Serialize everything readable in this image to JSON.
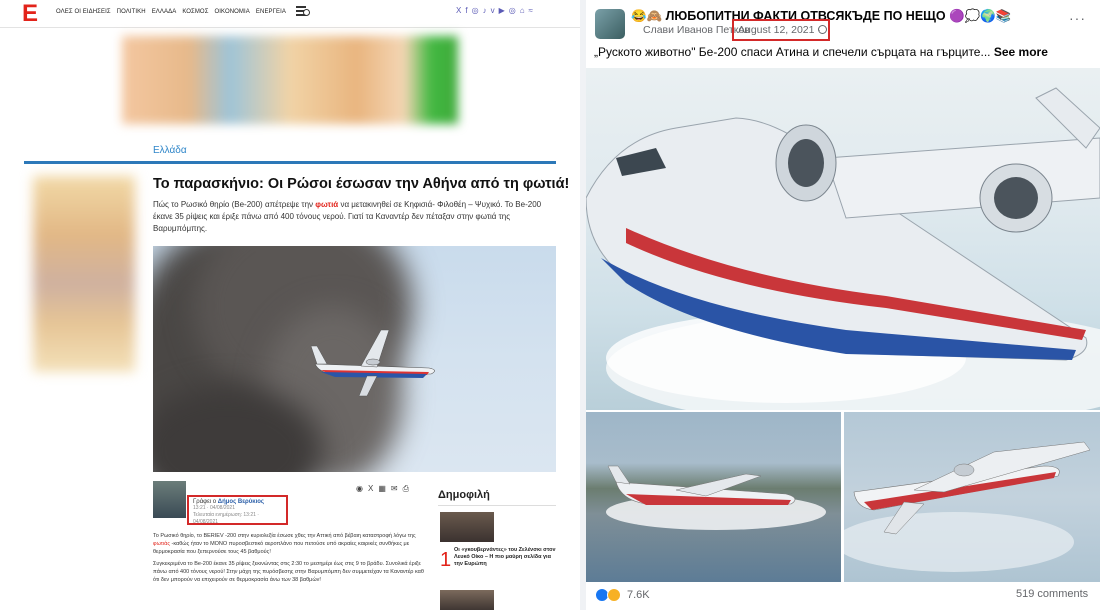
{
  "news_site": {
    "logo": "E",
    "nav": [
      "ΟΛΕΣ ΟΙ ΕΙΔΗΣΕΙΣ",
      "ΠΟΛΙΤΙΚΗ",
      "ΕΛΛΑΔΑ",
      "ΚΟΣΜΟΣ",
      "ΟΙΚΟΝΟΜΙΑ",
      "ΕΝΕΡΓΕΙΑ"
    ],
    "social_icons": [
      "X",
      "f",
      "◎",
      "♪",
      "v",
      "▶",
      "◎",
      "⌂",
      "≈"
    ],
    "category": "Ελλάδα",
    "article": {
      "title": "Το παρασκήνιο: Οι Ρώσοι έσωσαν την Αθήνα από τη φωτιά!",
      "lead_before": "Πώς το Ρωσικό θηρίο (Be-200) απέτρεψε την ",
      "lead_highlight": "φωτιά",
      "lead_after": " να μετακινηθεί σε Κηφισιά- Φιλοθέη – Ψυχικό. Το Be-200 έκανε 35 ρίψεις και έριξε πάνω από 400 τόνους νερού. Γιατί τα Καναντέρ δεν πέταξαν στην φωτιά της Βαρυμπόμπης.",
      "author_prefix": "Γράφει ο ",
      "author_name": "Δήμος Βερύκιος",
      "time_published": "13:21 · 04/08/2021",
      "time_updated": "Τελευταία ενημέρωση: 13:21 · 04/08/2021",
      "share_icons": [
        "◉",
        "X",
        "▦",
        "✉",
        "⎙"
      ],
      "body_p1_before": "Το Ρωσικό θηρίο, το BERIEV -200 στην κυριολεξία έσωσε χθες την Αττική από βέβαιη καταστροφή λόγω της ",
      "body_p1_highlight": "φωτιάς",
      "body_p1_after": " -καθώς ήταν το ΜΟΝΟ πυροσβεστικό αεροπλάνο που πετούσε υπό ακραίες καιρικές συνθήκες με θερμοκρασία που ξεπερνούσε τους 45 βαθμούς!",
      "body_p2": "Συγκεκριμένα το Be-200 έκανε 35 ρίψεις ξεκινώντας στις 2:30 το μεσημέρι έως στις 9 το βράδυ. Συνολικά έριξε πάνω από 400 τόνους νερού! Στην μάχη της πυρόσβεσης στην Βαρυμπόμπη δεν συμμετείχαν τα Καναντέρ καθ ότι δεν μπορούν να επιχειρούν σε θερμοκρασία άνω των 38 βαθμών!"
    },
    "popular": {
      "title": "Δημοφιλή",
      "rank": "1",
      "item_text": "Οι «γκουβερνάντες» του Ζελένσκι στον Λευκό Οίκο – Η πιο μαύρη σελίδα για την Ευρώπη"
    }
  },
  "facebook_post": {
    "page_name": "😂🙈 ЛЮБОПИТНИ ФАКТИ ОТВСЯКЪДЕ ПО НЕЩО 🟣💭🌍📚",
    "author": "Слави Иванов Петков",
    "date": "August 12, 2021 ·",
    "text": "„Руското животно\" Бе-200 спаси Атина и спечели сърцата на гърците...",
    "see_more": "See more",
    "more_icon": "···",
    "reaction_count": "7.6K",
    "comment_count": "519 comments"
  }
}
